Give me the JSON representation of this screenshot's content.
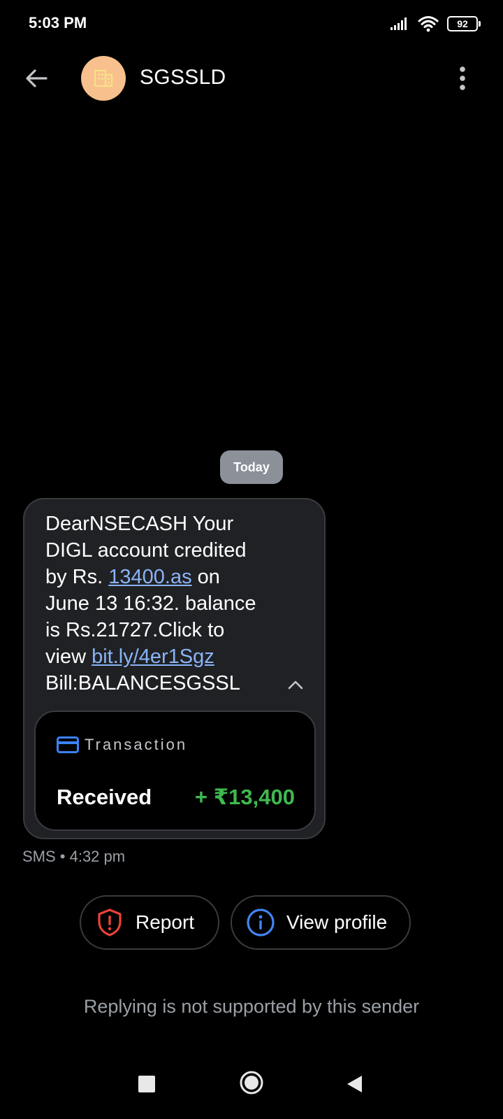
{
  "status_bar": {
    "time": "5:03 PM",
    "battery_level": "92"
  },
  "app_bar": {
    "contact_name": "SGSSLD",
    "avatar_color": "#f7c08c"
  },
  "conversation": {
    "date_chip": "Today",
    "message": {
      "text_part1": "DearNSECASH Your\nDIGL account credited\nby Rs. ",
      "link1": "13400.as",
      "text_part2": " on\nJune 13 16:32. balance\nis Rs.21727.Click to\nview ",
      "link2": "bit.ly/4er1Sgz",
      "text_part3": "\nBill:BALANCESGSSL"
    },
    "transaction": {
      "label": "Transaction",
      "type": "Received",
      "amount": "+ ₹13,400",
      "amount_color": "#3fb950"
    },
    "meta": "SMS • 4:32 pm"
  },
  "actions": {
    "report_label": "Report",
    "view_profile_label": "View profile"
  },
  "reply_note": "Replying is not supported by this sender"
}
